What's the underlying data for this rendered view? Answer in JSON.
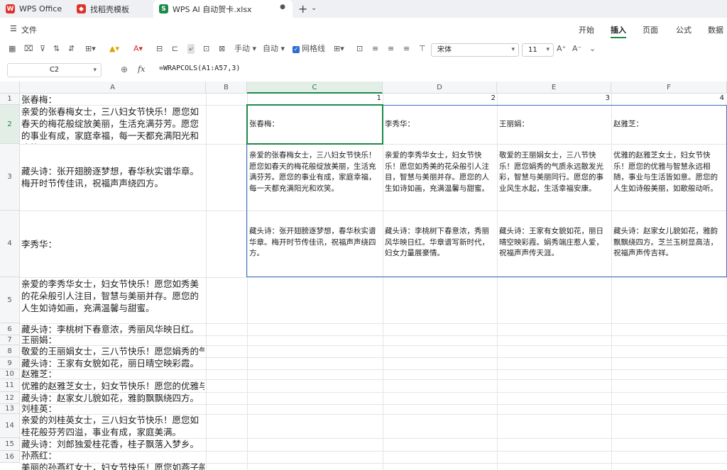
{
  "tabs": [
    {
      "label": "WPS Office",
      "icon": "wps-logo-icon"
    },
    {
      "label": "找稻壳模板",
      "icon": "docer-icon"
    },
    {
      "label": "WPS AI 自动贺卡.xlsx",
      "icon": "spreadsheet-icon"
    }
  ],
  "menu": {
    "file": "文件",
    "items": [
      "开始",
      "插入",
      "页面",
      "公式",
      "数据"
    ],
    "active": "插入"
  },
  "toolbar": {
    "manual": "手动",
    "auto": "自动",
    "gridlines": "网格线",
    "font": "宋体",
    "font_size": "11"
  },
  "formula_bar": {
    "name_box": "C2",
    "fx": "fx",
    "formula": "=WRAPCOLS(A1:A57,3)"
  },
  "colors": {
    "accent": "#1a8a4b",
    "selection": "#3a6fc4"
  },
  "columns": [
    "A",
    "B",
    "C",
    "D",
    "E",
    "F"
  ],
  "selected_column": "C",
  "row_numbers": [
    "1",
    "2",
    "3",
    "4",
    "5",
    "6",
    "7",
    "8",
    "9",
    "10",
    "11",
    "12",
    "13",
    "14",
    "15",
    "16"
  ],
  "colA": [
    "张春梅：",
    "亲爱的张春梅女士，三八妇女节快乐！愿您如春天的梅花般绽放美丽，生活充满芬芳。愿您的事业有成，家庭幸福，每一天都充满阳光和欢笑。",
    "藏头诗：张开翅膀逐梦想，春华秋实谱华章。梅开时节传佳讯，祝福声声绕四方。",
    "李秀华：",
    "亲爱的李秀华女士，妇女节快乐！愿您如秀美的花朵般引人注目，智慧与美丽并存。愿您的人生如诗如画，充满温馨与甜蜜。",
    "藏头诗：李桃树下春意浓，秀丽风华映日红。",
    "王丽娟：",
    "敬爱的王丽娟女士，三八节快乐！愿您娟秀的气质永远散发光彩。",
    "藏头诗：王家有女貌如花，丽日晴空映彩霞。",
    "赵雅芝：",
    "优雅的赵雅芝女士，妇女节快乐！愿您的优雅与智慧永远相随。",
    "藏头诗：赵家女儿貌如花，雅韵飘飘绕四方。",
    "刘桂英：",
    "亲爱的刘桂英女士，三八妇女节快乐！愿您如桂花般芬芳四溢，事业有成，家庭美满。",
    "藏头诗：刘郎独爱桂花香，桂子飘落入梦乡。",
    "孙燕红：",
    "美丽的孙燕红女士，妇女节快乐！愿您如燕子般自由。"
  ],
  "spill_numbers": [
    "1",
    "2",
    "3",
    "4"
  ],
  "spill": {
    "C": [
      "张春梅：",
      "亲爱的张春梅女士，三八妇女节快乐！愿您如春天的梅花般绽放美丽，生活充满芬芳。愿您的事业有成，家庭幸福，每一天都充满阳光和欢笑。",
      "藏头诗：张开翅膀逐梦想，春华秋实谱华章。梅开时节传佳讯，祝福声声绕四方。"
    ],
    "D": [
      "李秀华：",
      "亲爱的李秀华女士，妇女节快乐！愿您如秀美的花朵般引人注目，智慧与美丽并存。愿您的人生如诗如画，充满温馨与甜蜜。",
      "藏头诗：李桃树下春意浓，秀丽风华映日红。华章谱写新时代，妇女力量展豪情。"
    ],
    "E": [
      "王丽娟：",
      "敬爱的王丽娟女士，三八节快乐！愿您娟秀的气质永远散发光彩，智慧与美丽同行。愿您的事业风生水起，生活幸福安康。",
      "藏头诗：王家有女貌如花，丽日晴空映彩霞。娟秀端庄惹人爱，祝福声声传天涯。"
    ],
    "F": [
      "赵雅芝：",
      "优雅的赵雅芝女士，妇女节快乐！愿您的优雅与智慧永远相随，事业与生活皆如意。愿您的人生如诗般美丽，如歌般动听。",
      "藏头诗：赵家女儿貌如花，雅韵飘飘绕四方。芝兰玉树显高洁，祝福声声传吉祥。"
    ]
  }
}
